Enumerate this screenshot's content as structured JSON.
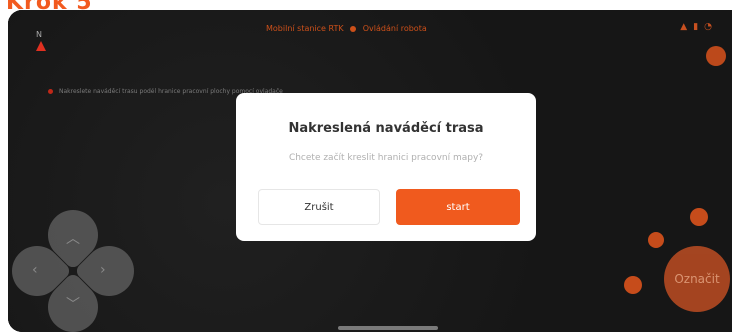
{
  "step_label": "Krok 5",
  "status_bar": {
    "left_text": "Mobilní stanice RTK",
    "right_text": "Ovládání robota",
    "icons": [
      "signal-icon",
      "battery-icon",
      "wifi-icon"
    ]
  },
  "map": {
    "north_label": "N",
    "hint": "Nakreslete naváděcí trasu podél hranice pracovní plochy pomocí ovladače"
  },
  "dialog": {
    "title": "Nakreslená naváděcí trasa",
    "message": "Chcete začít kreslit hranici pracovní mapy?",
    "cancel_label": "Zrušit",
    "confirm_label": "start"
  },
  "controls": {
    "mark_label": "Označit"
  },
  "colors": {
    "accent": "#f05a1e",
    "background": "#171717",
    "dialog": "#ffffff"
  }
}
